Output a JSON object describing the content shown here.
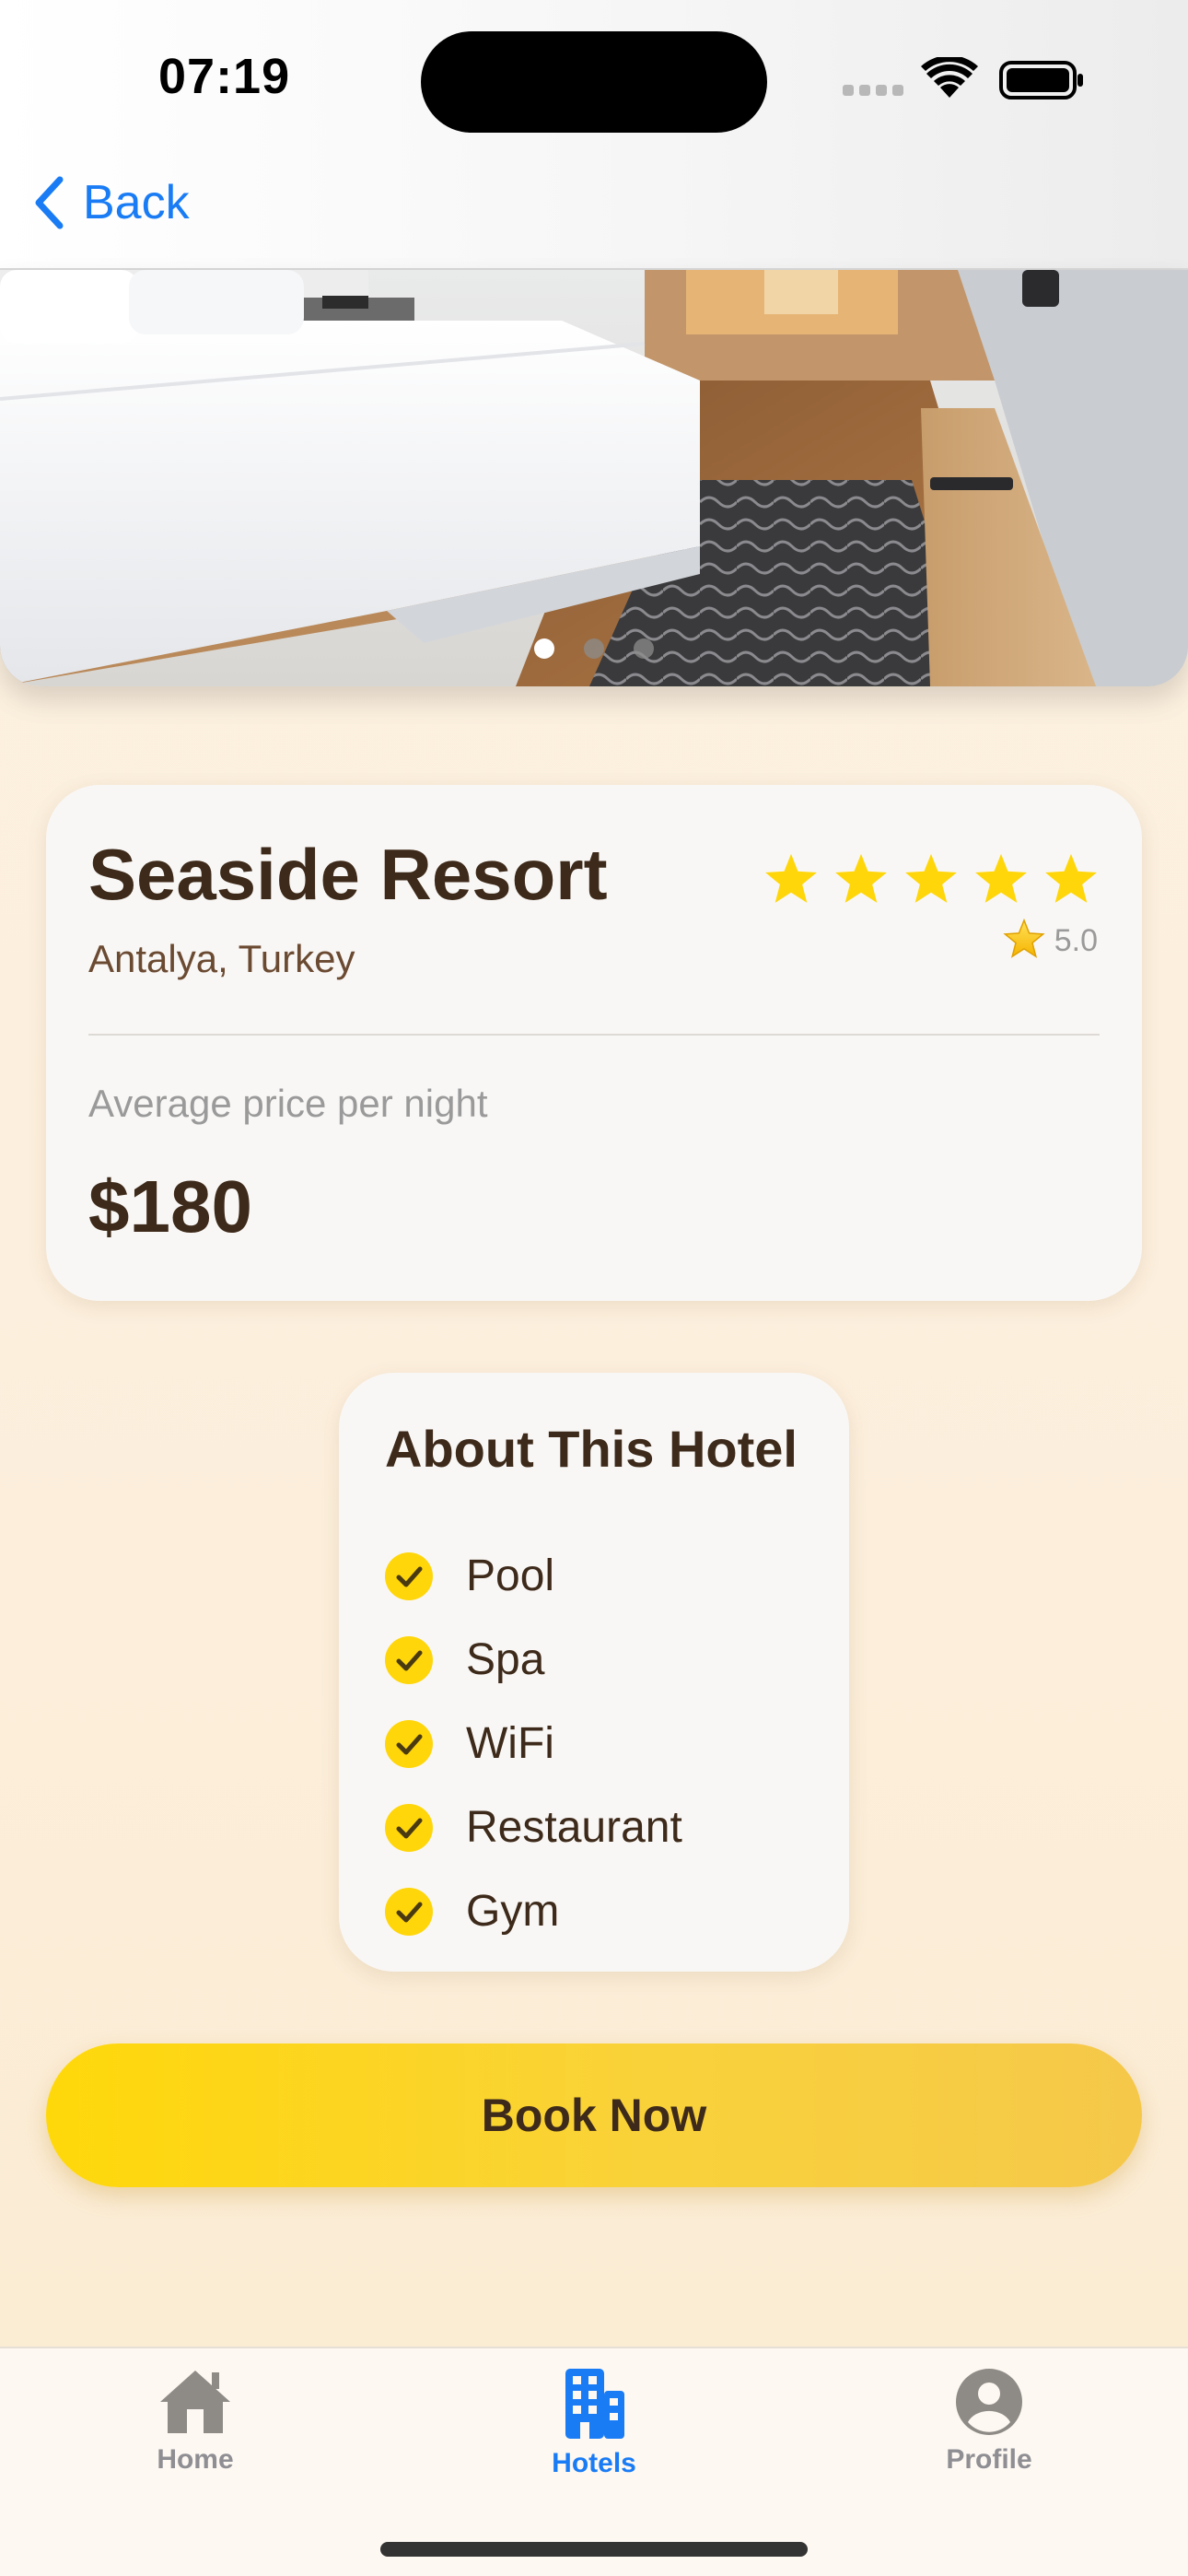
{
  "status_bar": {
    "time": "07:19",
    "icons": [
      "cellular-signal-icon",
      "wifi-icon",
      "battery-icon"
    ]
  },
  "nav": {
    "back_label": "Back",
    "back_icon": "chevron-left-icon",
    "accent_color": "#1A7CF5"
  },
  "hero": {
    "image": "hotel-room-photo",
    "page_count": 3,
    "active_page": 1
  },
  "hotel": {
    "name": "Seaside Resort",
    "location": "Antalya, Turkey",
    "star_count": 5,
    "rating_icon": "star-emoji-icon",
    "rating": "5.0",
    "price_label": "Average price per night",
    "price": "$180"
  },
  "about": {
    "title": "About This Hotel",
    "amenities": [
      "Pool",
      "Spa",
      "WiFi",
      "Restaurant",
      "Gym"
    ],
    "check_icon": "checkmark-circle-icon",
    "check_color": "#FFD60A"
  },
  "actions": {
    "book_label": "Book Now",
    "book_color": "#FFD60A"
  },
  "tab_bar": {
    "tabs": [
      {
        "label": "Home",
        "icon": "house-icon",
        "active": false
      },
      {
        "label": "Hotels",
        "icon": "building-icon",
        "active": true
      },
      {
        "label": "Profile",
        "icon": "person-circle-icon",
        "active": false
      }
    ]
  }
}
